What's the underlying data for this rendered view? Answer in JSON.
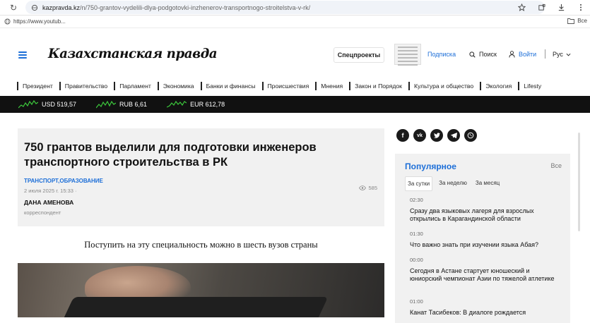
{
  "browser": {
    "url_host": "kazpravda.kz",
    "url_path": "/n/750-grantov-vydelili-dlya-podgotovki-inzhenerov-transportnogo-stroitelstva-v-rk/",
    "bookmark": "https://www.youtub...",
    "bookmark_right": "Все"
  },
  "header": {
    "logo": "Казахстанская правда",
    "special": "Спецпроекты",
    "subscribe": "Подписка",
    "search": "Поиск",
    "login": "Войти",
    "lang": "Рус"
  },
  "nav": [
    "Президент",
    "Правительство",
    "Парламент",
    "Экономика",
    "Банки и финансы",
    "Происшествия",
    "Мнения",
    "Закон и Порядок",
    "Культура и общество",
    "Экология",
    "Lifesty"
  ],
  "fx": [
    {
      "label": "USD 519,57"
    },
    {
      "label": "RUB 6,61"
    },
    {
      "label": "EUR 612,78"
    }
  ],
  "article": {
    "title": "750 грантов выделили для подготовки инженеров транспортного строительства в РК",
    "categories": "ТРАНСПОРТ,ОБРАЗОВАНИЕ",
    "date": "2 июля 2025 г. 15:33 ·",
    "views": "585",
    "author": "ДАНА АМЕНОВА",
    "role": "корреспондент",
    "lead": "Поступить на эту специальность можно в шесть вузов страны"
  },
  "popular": {
    "title": "Популярное",
    "all": "Все",
    "tabs": [
      "За сутки",
      "За неделю",
      "За месяц"
    ],
    "items": [
      {
        "time": "02:30",
        "text": "Сразу два языковых лагеря для взрослых открылись в Карагандинской области"
      },
      {
        "time": "01:30",
        "text": "Что важно знать при изучении языка Абая?"
      },
      {
        "time": "00:00",
        "text": "Сегодня в Астане стартует юношеский и юниорский чемпионат Азии по тяжелой атлетике"
      },
      {
        "time": "01:00",
        "text": "Канат Тасибеков: В диалоге рождается"
      }
    ]
  },
  "colors": {
    "accent": "#1d6fd8",
    "fx_bar": "#111111",
    "card_bg": "#f1f1f1"
  }
}
